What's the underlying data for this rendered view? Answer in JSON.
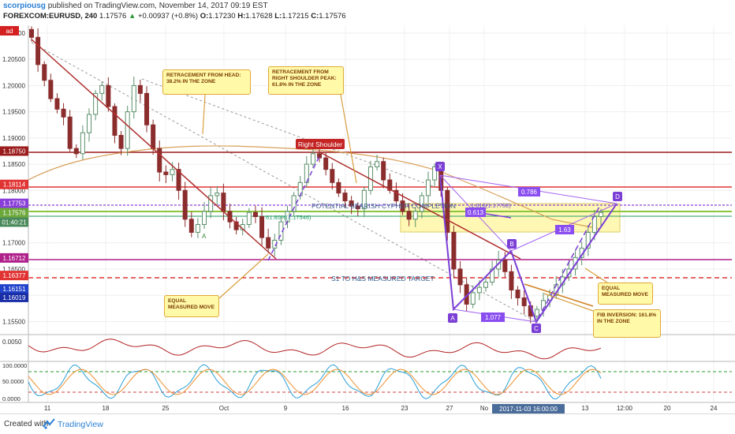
{
  "header": {
    "author": "scorpiousg",
    "published": "published on TradingView.com, November 14, 2017 09:19 EST",
    "symbol": "FOREXCOM:EURUSD, 240",
    "last": "1.17576",
    "arrow": "▲",
    "change": "+0.00937 (+0.8%)",
    "open_label": "O:",
    "open": "1.17230",
    "high_label": "H:",
    "high": "1.17628",
    "low_label": "L:",
    "low": "1.17215",
    "close_label": "C:",
    "close": "1.17576"
  },
  "footer": {
    "created_with": "Created with",
    "brand": "TradingView",
    "logo_icon": "tradingview-logo-icon"
  },
  "colors": {
    "bull": "#5b8f6a",
    "bear": "#8b2d2d",
    "trend": "#b03030",
    "pattern": "#7b3fd6",
    "zone": "#fff7a8",
    "ema": "#d8a05a",
    "green_line": "#8cc63f",
    "rsi": "#b22222",
    "stoch_k": "#2b9fd8",
    "stoch_d": "#f09030"
  },
  "price_labels": {
    "ticks": [
      "1.21000",
      "1.20500",
      "1.20000",
      "1.19500",
      "1.19000",
      "1.18500",
      "1.18000",
      "1.17500",
      "1.17000",
      "1.16500",
      "1.16000",
      "1.15500"
    ],
    "badges": [
      "1.18750",
      "1.18114",
      "1.17753",
      "1.17576",
      "01:40:21",
      "1.16712",
      "1.16377",
      "1.16151",
      "1.16019"
    ],
    "top_clip": "ad"
  },
  "rsi_ticks": [
    "0.0050"
  ],
  "stoch_ticks": [
    "100.0000",
    "50.0000",
    "0.0000"
  ],
  "time_labels": [
    "11",
    "18",
    "25",
    "Oct",
    "9",
    "16",
    "23",
    "27",
    "No",
    "13",
    "12:00",
    "20",
    "24"
  ],
  "time_cursor": "2017-11-03 16:00:00",
  "annotations": {
    "right_shoulder": "Right Shoulder",
    "retrace_head": "RETRACEMENT FROM HEAD: 38.2% IN THE ZONE",
    "retrace_shoulder": "RETRACEMENT FROM RIGHT SHOULDER PEAK: 61.8% IN THE ZONE",
    "equal_move_1": "EQUAL MEASURED MOVE",
    "equal_move_2": "EQUAL MEASURED MOVE",
    "fib_inversion": "FIB INVERSION: 161.8% IN THE ZONE",
    "cypher": "POTENTIAL BEARISH CYPHER COMPLETION",
    "s1_target": "S1 TO H&S MEASURED TARGET",
    "fib_618": "61.80%(1.17546)",
    "fib_1618": "1.618(1.17730)",
    "ratio_0786": "0.786",
    "ratio_1077": "1.077",
    "ratio_163": "1.63",
    "ratio_0613": "0.613",
    "point_x": "X",
    "point_a": "A",
    "point_b": "B",
    "point_c": "C",
    "point_d": "D",
    "small_marker": "A"
  },
  "chart_data": {
    "type": "candlestick",
    "title": "FOREXCOM:EURUSD, 240",
    "xlabel": "",
    "ylabel": "",
    "x_ticks": [
      "11",
      "18",
      "25",
      "Oct",
      "9",
      "16",
      "23",
      "27",
      "No",
      "13",
      "12:00",
      "20",
      "24"
    ],
    "ylim": [
      1.1525,
      1.2115
    ],
    "series": [
      {
        "name": "EURUSD close",
        "values": [
          1.2092,
          1.204,
          1.201,
          1.1975,
          1.1955,
          1.194,
          1.188,
          1.187,
          1.191,
          1.1945,
          1.1985,
          1.2,
          1.196,
          1.1905,
          1.188,
          1.195,
          1.2,
          1.1985,
          1.1925,
          1.188,
          1.1835,
          1.183,
          1.184,
          1.18,
          1.1745,
          1.172,
          1.1735,
          1.176,
          1.179,
          1.1795,
          1.176,
          1.174,
          1.1725,
          1.1735,
          1.1758,
          1.175,
          1.171,
          1.169,
          1.1705,
          1.174,
          1.176,
          1.179,
          1.1815,
          1.185,
          1.187,
          1.1862,
          1.184,
          1.1815,
          1.1795,
          1.178,
          1.177,
          1.1765,
          1.18,
          1.1845,
          1.1855,
          1.182,
          1.18,
          1.178,
          1.176,
          1.1745,
          1.176,
          1.179,
          1.182,
          1.1845,
          1.18,
          1.172,
          1.165,
          1.162,
          1.1583,
          1.1605,
          1.1615,
          1.1625,
          1.165,
          1.1667,
          1.1645,
          1.161,
          1.1595,
          1.158,
          1.156,
          1.1573,
          1.159,
          1.16,
          1.162,
          1.1635,
          1.165,
          1.1672,
          1.169,
          1.172,
          1.175,
          1.1758
        ]
      }
    ],
    "horizontal_levels": [
      {
        "label": "1.18750",
        "value": 1.1875
      },
      {
        "label": "1.18114",
        "value": 1.18114
      },
      {
        "label": "1.17753",
        "value": 1.17753
      },
      {
        "label": "1.17576",
        "value": 1.17576
      },
      {
        "label": "1.16712",
        "value": 1.16712
      },
      {
        "label": "1.16377",
        "value": 1.16377
      }
    ],
    "cypher_points": [
      {
        "label": "X",
        "value": 1.1835
      },
      {
        "label": "A",
        "value": 1.1576
      },
      {
        "label": "B",
        "value": 1.1668
      },
      {
        "label": "C",
        "value": 1.1556
      },
      {
        "label": "D",
        "value": 1.1775
      }
    ],
    "indicators": [
      {
        "name": "RSI-like oscillator",
        "ylim": [
          0,
          0.0075
        ]
      },
      {
        "name": "Stochastic",
        "ylim": [
          0,
          100
        ],
        "levels": [
          80,
          20
        ]
      }
    ]
  }
}
